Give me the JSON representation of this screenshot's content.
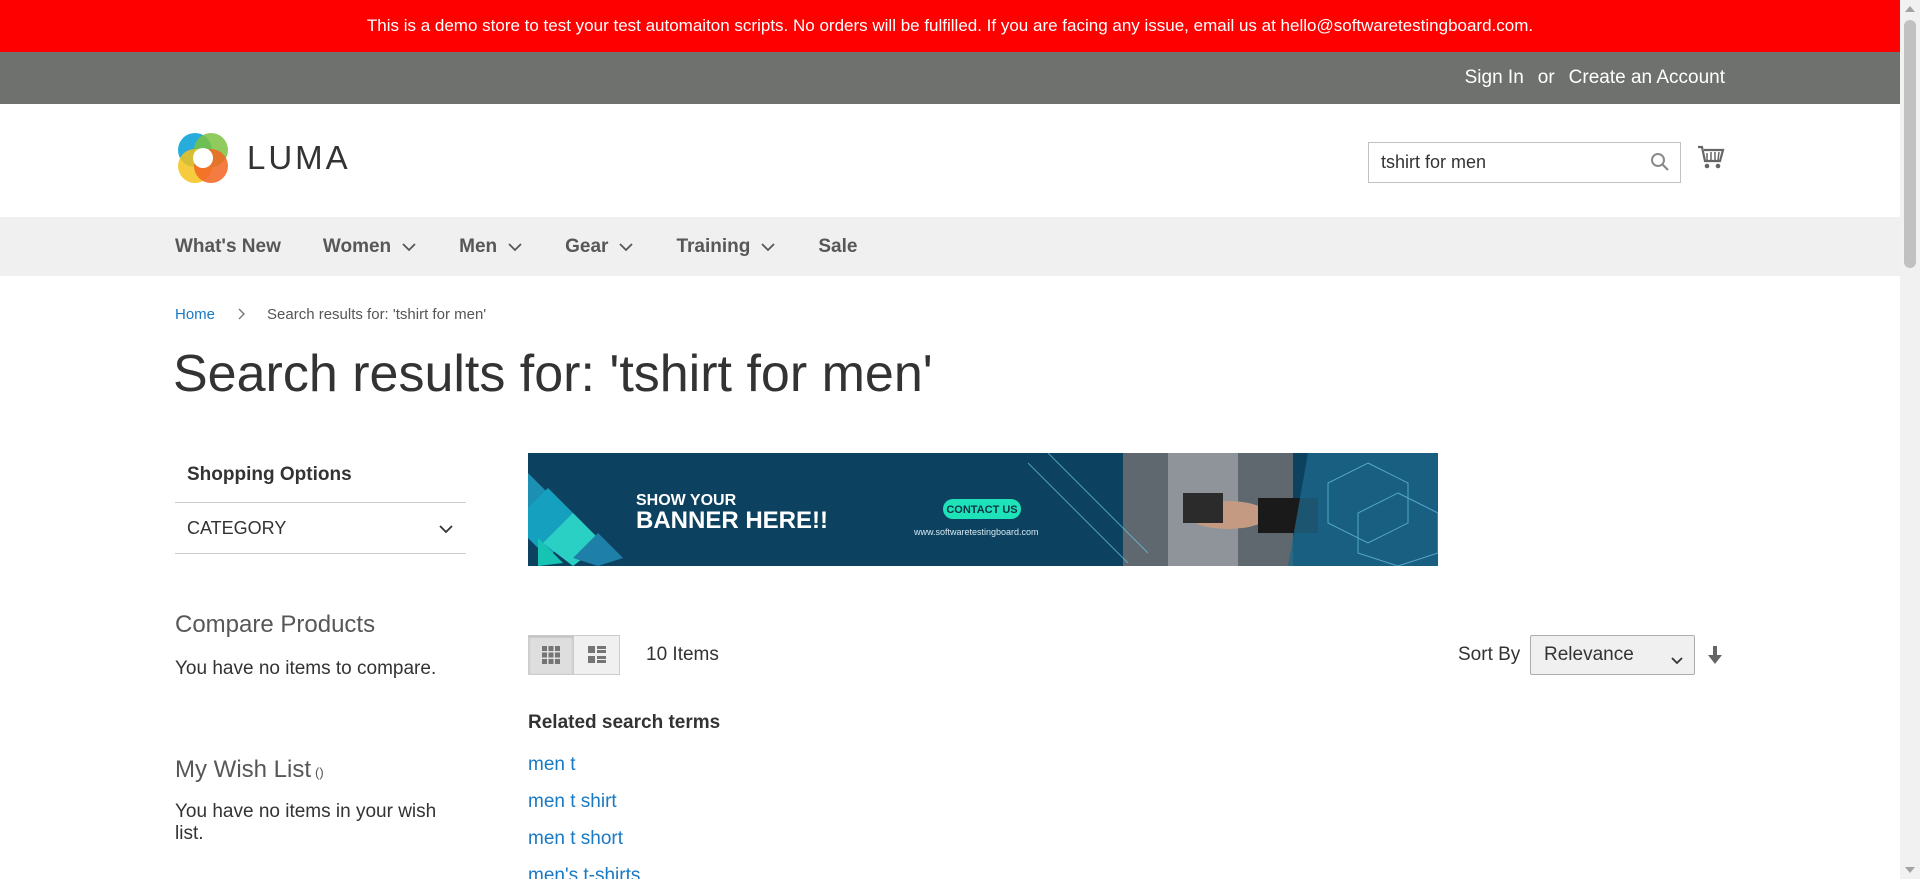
{
  "demo_notice": "This is a demo store to test your test automaiton scripts. No orders will be fulfilled. If you are facing any issue, email us at hello@softwaretestingboard.com.",
  "top_links": {
    "sign_in": "Sign In",
    "or": "or",
    "create_account": "Create an Account"
  },
  "logo": {
    "text": "LUMA"
  },
  "search": {
    "value": "tshirt for men",
    "icon": "search-icon"
  },
  "cart": {
    "icon": "cart-icon"
  },
  "nav": [
    {
      "label": "What's New",
      "has_dropdown": false
    },
    {
      "label": "Women",
      "has_dropdown": true
    },
    {
      "label": "Men",
      "has_dropdown": true
    },
    {
      "label": "Gear",
      "has_dropdown": true
    },
    {
      "label": "Training",
      "has_dropdown": true
    },
    {
      "label": "Sale",
      "has_dropdown": false
    }
  ],
  "breadcrumb": {
    "home": "Home",
    "separator": ">",
    "current": "Search results for: 'tshirt for men'"
  },
  "page_title": "Search results for: 'tshirt for men'",
  "sidebar": {
    "shopping_options": "Shopping Options",
    "category": "CATEGORY",
    "compare_title": "Compare Products",
    "compare_text": "You have no items to compare.",
    "wishlist_title": "My Wish List",
    "wishlist_count": "()",
    "wishlist_text": "You have no items in your wish list."
  },
  "banner": {
    "line1": "SHOW YOUR",
    "line2": "BANNER HERE!!",
    "cta": "CONTACT US",
    "url": "www.softwaretestingboard.com"
  },
  "toolbar": {
    "count": "10 Items",
    "sort_label": "Sort By",
    "sort_value": "Relevance"
  },
  "related": {
    "title": "Related search terms",
    "terms": [
      "men t",
      "men t shirt",
      "men t short",
      "men's t-shirts"
    ]
  },
  "colors": {
    "demo_bar": "#ff0000",
    "top_bar": "#6e716e",
    "nav_bg": "#f0f0f0",
    "link": "#1979c3"
  }
}
